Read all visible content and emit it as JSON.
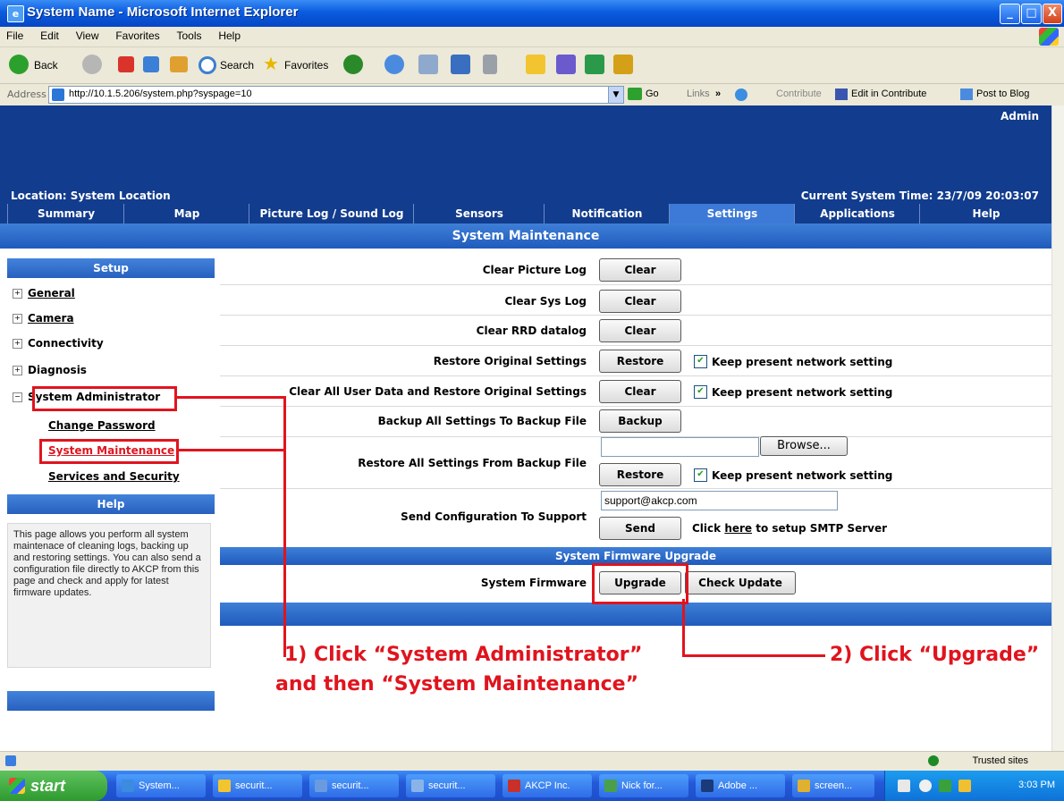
{
  "window": {
    "title": "System Name - Microsoft Internet Explorer",
    "minimize": "_",
    "maximize": "□",
    "close": "X"
  },
  "menu": [
    "File",
    "Edit",
    "View",
    "Favorites",
    "Tools",
    "Help"
  ],
  "toolbar": {
    "back": "Back",
    "search": "Search",
    "favorites": "Favorites"
  },
  "address": {
    "label": "Address",
    "url": "http://10.1.5.206/system.php?syspage=10",
    "go": "Go",
    "links": "Links",
    "contribute": "Contribute",
    "edit_contribute": "Edit in Contribute",
    "post_blog": "Post to Blog"
  },
  "banner": {
    "user": "Admin",
    "location": "Location: System Location",
    "time": "Current System Time: 23/7/09 20:03:07"
  },
  "tabs": [
    "Summary",
    "Map",
    "Picture Log / Sound Log",
    "Sensors",
    "Notification",
    "Settings",
    "Applications",
    "Help"
  ],
  "section_title": "System Maintenance",
  "sidebar": {
    "setup_header": "Setup",
    "items": [
      "General",
      "Camera",
      "Connectivity",
      "Diagnosis",
      "System Administrator"
    ],
    "subitems": [
      "Change Password",
      "System Maintenance",
      "Services and Security"
    ],
    "help_header": "Help",
    "help_text": "This page allows you perform all system maintenace of cleaning logs, backing up and restoring settings. You can also send a configuration file directly to AKCP from this page and check and apply for latest firmware updates."
  },
  "form": {
    "clear_picture_log": "Clear Picture Log",
    "clear_sys_log": "Clear Sys Log",
    "clear_rrd": "Clear RRD datalog",
    "restore_original": "Restore Original Settings",
    "clear_all": "Clear All User Data and Restore Original Settings",
    "backup_all": "Backup All Settings To Backup File",
    "restore_backup": "Restore All Settings From Backup File",
    "send_config": "Send Configuration To Support",
    "clear_btn": "Clear",
    "restore_btn": "Restore",
    "backup_btn": "Backup",
    "browse_btn": "Browse...",
    "send_btn": "Send",
    "keep_network": "Keep present network setting",
    "email_value": "support@akcp.com",
    "smtp_prefix": "Click ",
    "smtp_link": "here",
    "smtp_suffix": " to setup SMTP Server",
    "firmware_header": "System Firmware Upgrade",
    "firmware_label": "System Firmware",
    "upgrade_btn": "Upgrade",
    "check_update_btn": "Check Update"
  },
  "annotations": {
    "step1_line1": "1) Click “System Administrator”",
    "step1_line2": "and then “System Maintenance”",
    "step2": "2) Click “Upgrade”"
  },
  "statusbar": {
    "zone": "Trusted sites"
  },
  "taskbar": {
    "start": "start",
    "tasks": [
      "System...",
      "securit...",
      "securit...",
      "securit...",
      "AKCP Inc.",
      "Nick for...",
      "Adobe ...",
      "screen..."
    ],
    "clock": "3:03 PM"
  },
  "colors": {
    "banner": "#123c8d",
    "section": "#2f6bcf",
    "annotation": "#e0141e"
  }
}
